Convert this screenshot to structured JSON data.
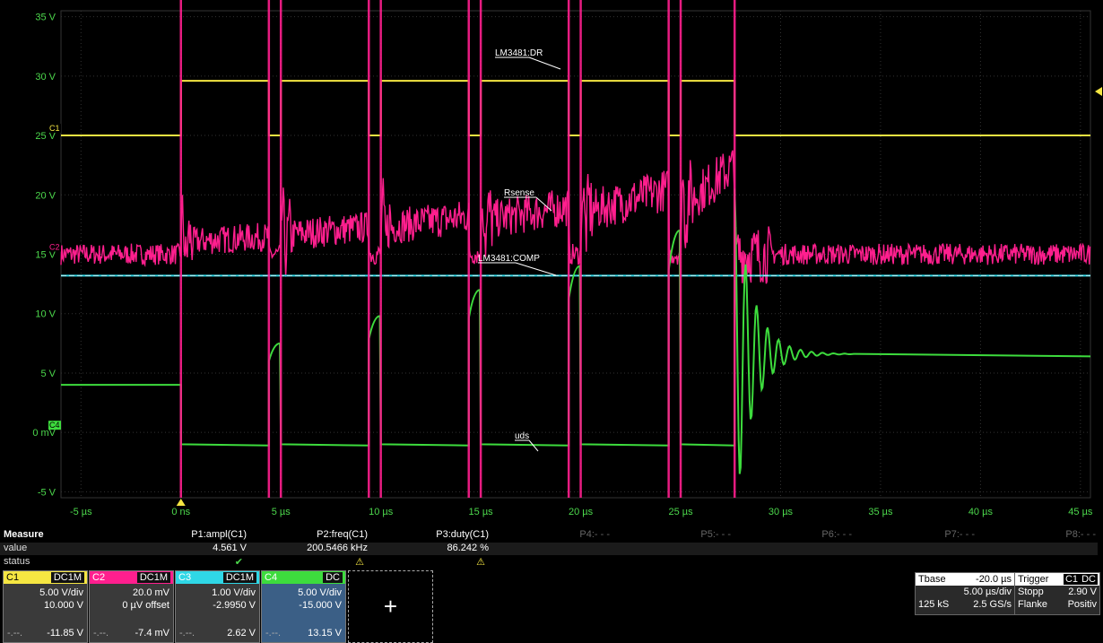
{
  "chart_data": {
    "type": "line",
    "xlabel": "",
    "ylabel": "",
    "x_ticks": [
      "-5 µs",
      "0 ns",
      "5 µs",
      "10 µs",
      "15 µs",
      "20 µs",
      "25 µs",
      "30 µs",
      "35 µs",
      "40 µs",
      "45 µs"
    ],
    "y_ticks": [
      "35 V",
      "30 V",
      "25 V",
      "20 V",
      "15 V",
      "10 V",
      "5 V",
      "0 mV",
      "-5 V"
    ],
    "xlim": [
      -6,
      45.5
    ],
    "ylim": [
      -5.5,
      35.5
    ],
    "grid": true,
    "annotations": [
      "LM3481:DR",
      "Rsense",
      "LM3481:COMP",
      "uds"
    ],
    "channel_markers": [
      "C1",
      "C2",
      "C4"
    ],
    "switch_intervals_us": [
      [
        0.0,
        4.4
      ],
      [
        5.0,
        9.4
      ],
      [
        10.0,
        14.4
      ],
      [
        15.0,
        19.4
      ],
      [
        20.0,
        24.4
      ],
      [
        25.0,
        27.7
      ]
    ],
    "series": [
      {
        "name": "LM3481:DR",
        "color": "#f5e642",
        "low": 25.0,
        "high": 29.6
      },
      {
        "name": "Rsense",
        "color": "#ff1f8e",
        "baseline": 15.0,
        "peak_values": [
          16.5,
          17.3,
          18.2,
          19.0,
          20.5,
          22.5
        ]
      },
      {
        "name": "LM3481:COMP",
        "color": "#2fd7e6",
        "level": 13.2
      },
      {
        "name": "uds",
        "color": "#3ddc3d",
        "pre_level": 4.0,
        "on_level": -1.0,
        "off_peaks": [
          7.5,
          9.8,
          12.0,
          14.0,
          17.0,
          20.5
        ],
        "final_level": 6.6
      }
    ]
  },
  "measure": {
    "title": "Measure",
    "row_value_label": "value",
    "row_status_label": "status",
    "params": [
      {
        "name": "P1:ampl(C1)",
        "value": "4.561 V",
        "status": "✔",
        "status_color": "#4cd84c"
      },
      {
        "name": "P2:freq(C1)",
        "value": "200.5466 kHz",
        "status": "⚠",
        "status_color": "#f5e642"
      },
      {
        "name": "P3:duty(C1)",
        "value": "86.242 %",
        "status": "⚠",
        "status_color": "#f5e642"
      },
      {
        "name": "P4:- - -",
        "value": "",
        "status": "",
        "status_color": "#555"
      },
      {
        "name": "P5:- - -",
        "value": "",
        "status": "",
        "status_color": "#555"
      },
      {
        "name": "P6:- - -",
        "value": "",
        "status": "",
        "status_color": "#555"
      },
      {
        "name": "P7:- - -",
        "value": "",
        "status": "",
        "status_color": "#555"
      },
      {
        "name": "P8:- - -",
        "value": "",
        "status": "",
        "status_color": "#555"
      }
    ]
  },
  "channels": [
    {
      "name": "C1",
      "coupling": "DC1M",
      "vdiv": "5.00 V/div",
      "offset": "10.000 V",
      "dash": "-.--.",
      "meas": "-11.85 V",
      "color": "#f5e642",
      "text": "#000"
    },
    {
      "name": "C2",
      "coupling": "DC1M",
      "vdiv": "20.0 mV",
      "offset": "0 µV offset",
      "dash": "-.--.",
      "meas": "-7.4 mV",
      "color": "#ff1f8e",
      "text": "#fff"
    },
    {
      "name": "C3",
      "coupling": "DC1M",
      "vdiv": "1.00 V/div",
      "offset": "-2.9950 V",
      "dash": "-.--.",
      "meas": "2.62 V",
      "color": "#2fd7e6",
      "text": "#fff"
    },
    {
      "name": "C4",
      "coupling": "DC",
      "vdiv": "5.00 V/div",
      "offset": "-15.000 V",
      "dash": "-.--.",
      "meas": "13.15 V",
      "color": "#3ddc3d",
      "text": "#fff"
    }
  ],
  "add_channel": "+",
  "tbase": {
    "label": "Tbase",
    "delay": "-20.0 µs",
    "scale": "5.00 µs/div",
    "samples": "125 kS",
    "rate": "2.5 GS/s"
  },
  "trigger": {
    "label": "Trigger",
    "src": "C1",
    "coup": "DC",
    "mode": "Stopp",
    "level": "2.90 V",
    "type": "Flanke",
    "slope": "Positiv"
  }
}
